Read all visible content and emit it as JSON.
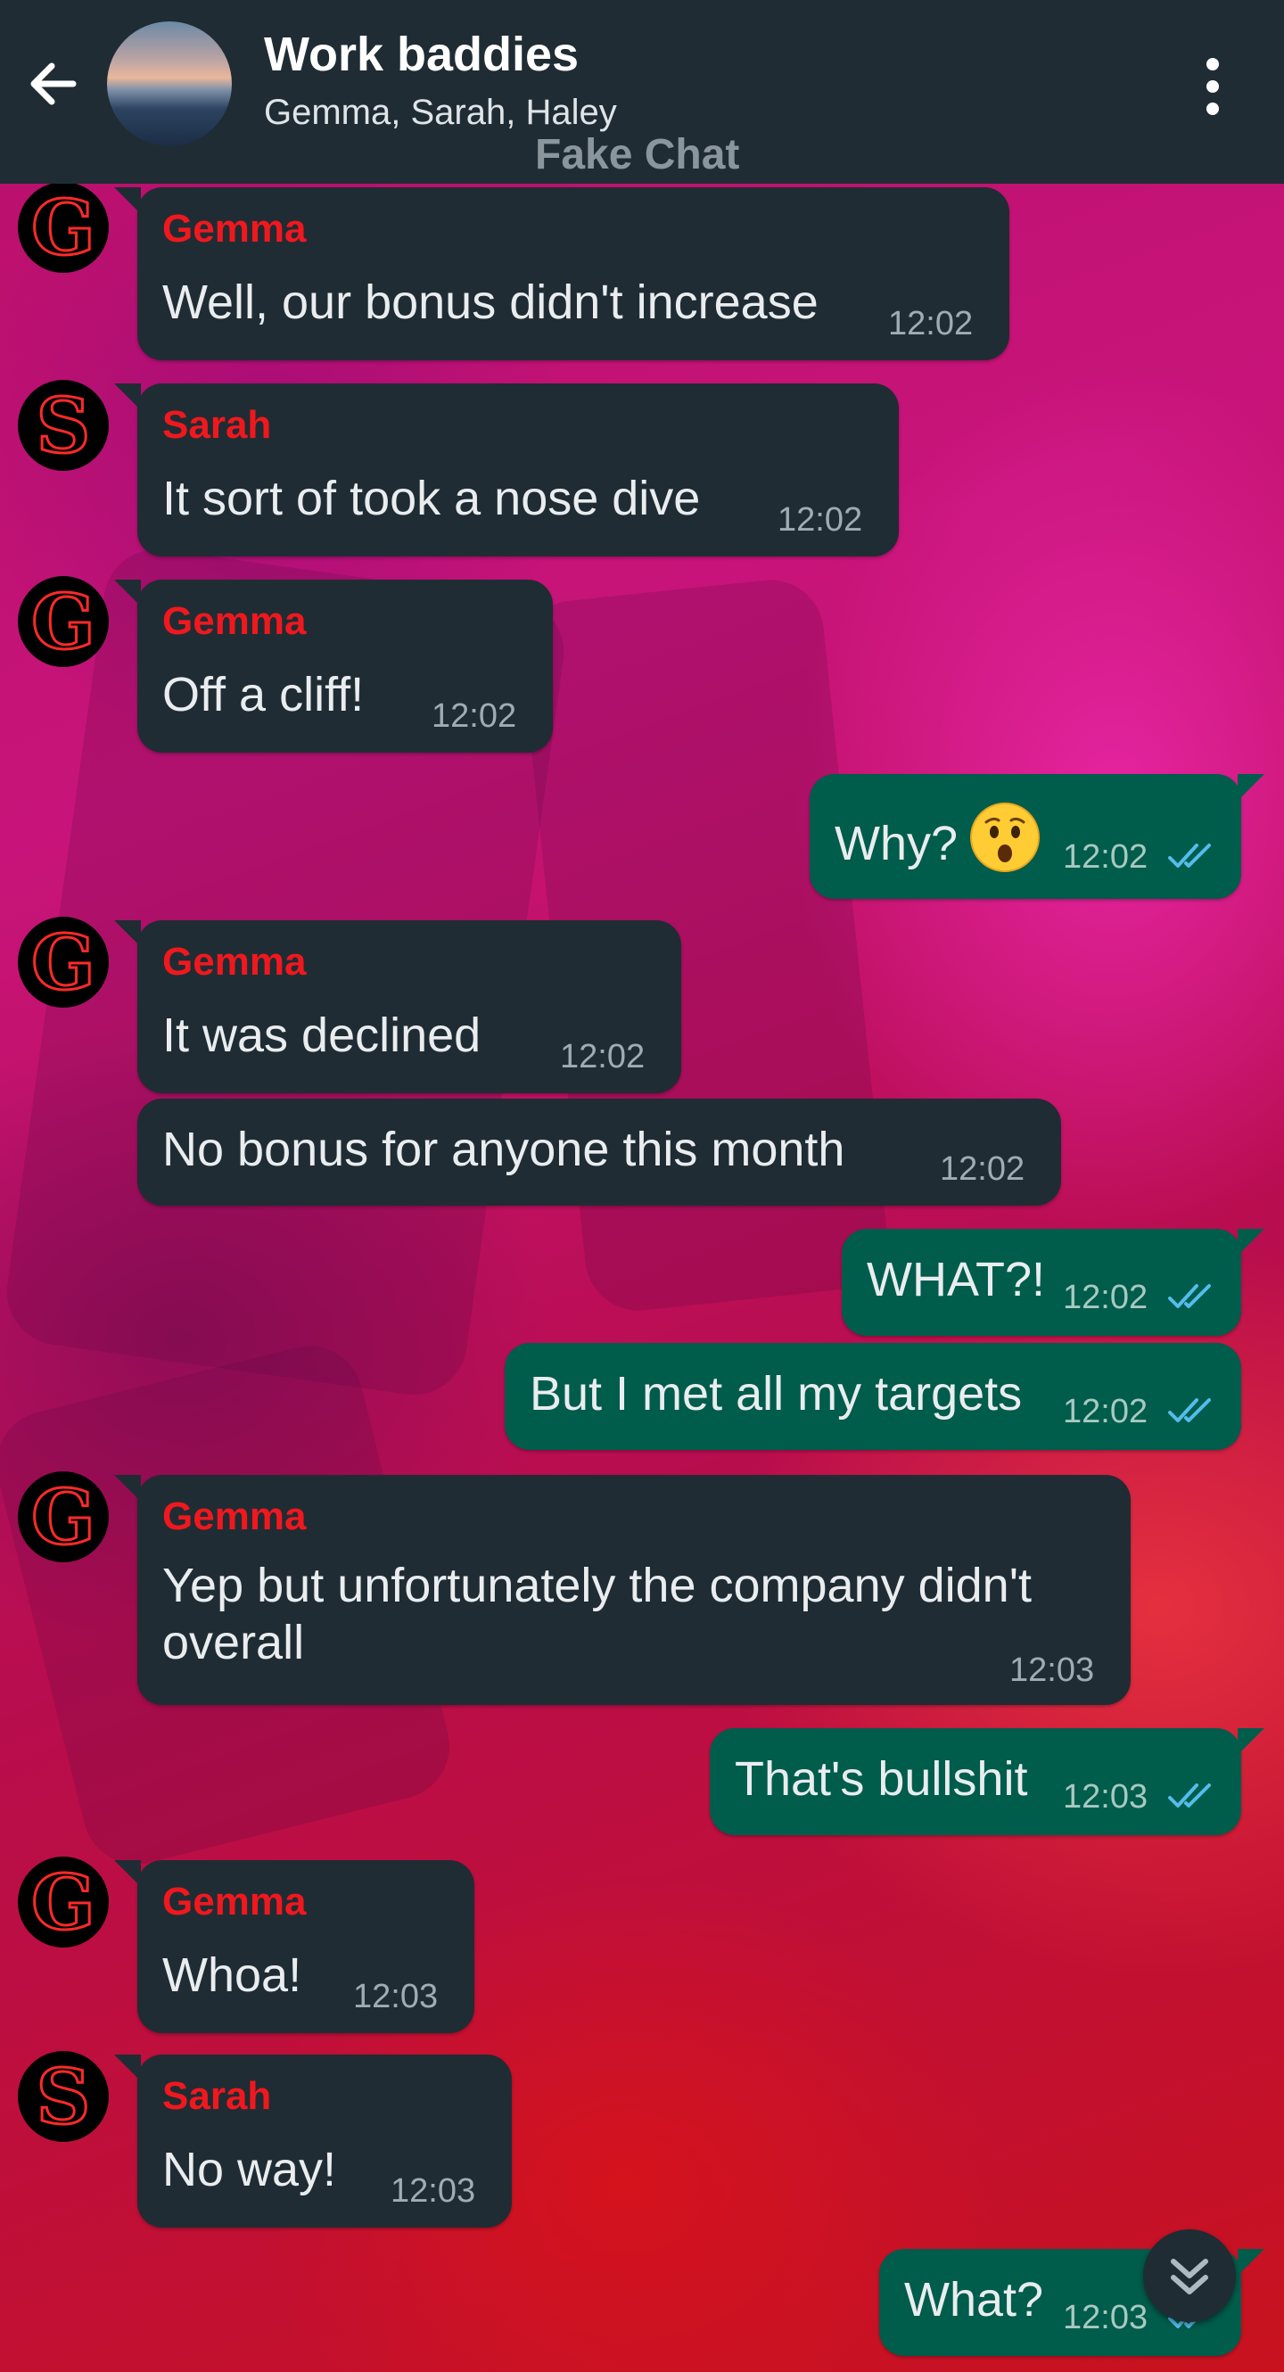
{
  "header": {
    "title": "Work baddies",
    "subtitle": "Gemma, Sarah, Haley",
    "watermark": "Fake Chat"
  },
  "colors": {
    "header_bg": "#1f2c34",
    "incoming_bubble": "#202c33",
    "outgoing_bubble": "#005c4b",
    "sender_name": "#f0181e",
    "read_ticks": "#53bdeb"
  },
  "messages": [
    {
      "dir": "in",
      "sender": "Gemma",
      "text": "Well, our bonus didn't increase",
      "time": "12:02"
    },
    {
      "dir": "in",
      "sender": "Sarah",
      "text": "It sort of took a nose dive",
      "time": "12:02"
    },
    {
      "dir": "in",
      "sender": "Gemma",
      "text": "Off a cliff!",
      "time": "12:02"
    },
    {
      "dir": "out",
      "text": "Why?",
      "emoji": "hushed-face",
      "time": "12:02",
      "status": "read"
    },
    {
      "dir": "in",
      "sender": "Gemma",
      "text": "It was declined",
      "time": "12:02"
    },
    {
      "dir": "in",
      "text": "No bonus for anyone this month",
      "time": "12:02"
    },
    {
      "dir": "out",
      "text": "WHAT?!",
      "time": "12:02",
      "status": "read"
    },
    {
      "dir": "out",
      "text": "But I met all my targets",
      "time": "12:02",
      "status": "read"
    },
    {
      "dir": "in",
      "sender": "Gemma",
      "text": "Yep but unfortunately the company didn't overall",
      "time": "12:03"
    },
    {
      "dir": "out",
      "text": "That's bullshit",
      "time": "12:03",
      "status": "read"
    },
    {
      "dir": "in",
      "sender": "Gemma",
      "text": "Whoa!",
      "time": "12:03"
    },
    {
      "dir": "in",
      "sender": "Sarah",
      "text": "No way!",
      "time": "12:03"
    },
    {
      "dir": "out",
      "text": "What?",
      "time": "12:03",
      "status": "read"
    }
  ],
  "avatars": {
    "Gemma": "G",
    "Sarah": "S"
  }
}
